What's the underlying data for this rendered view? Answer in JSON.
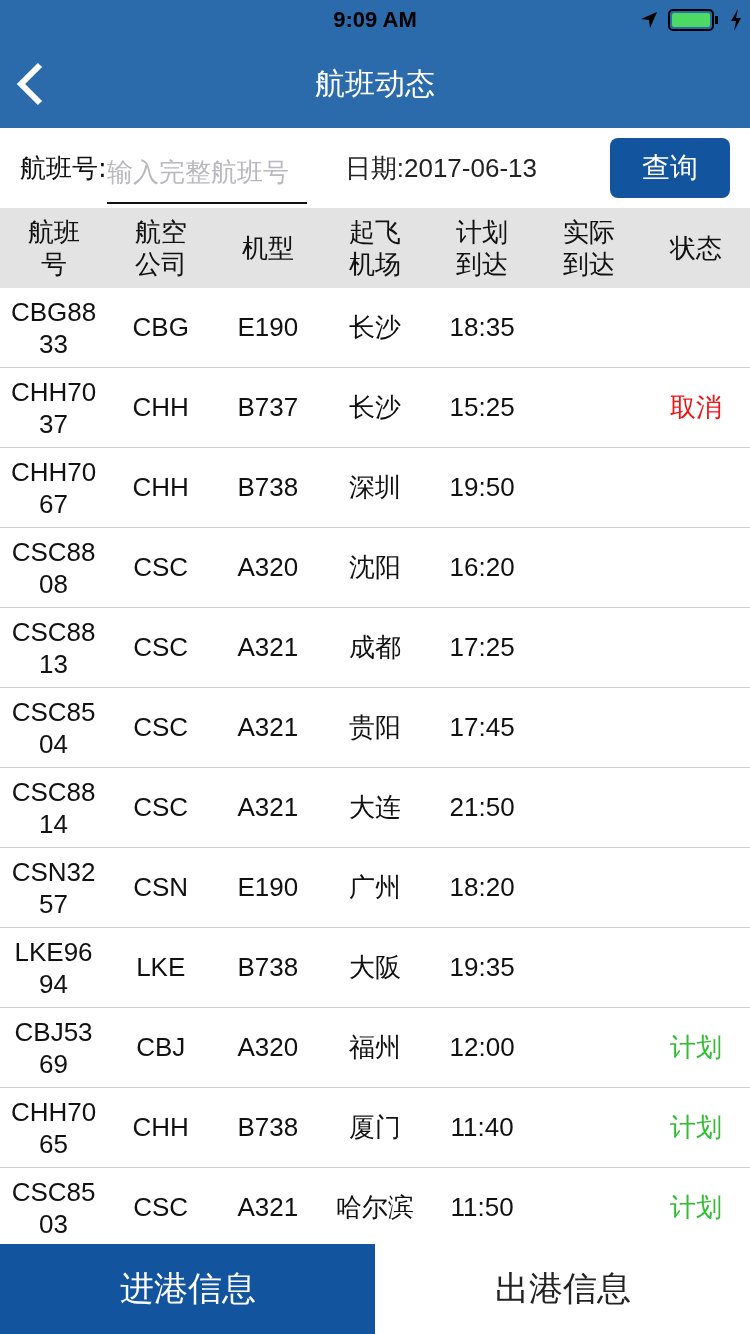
{
  "status_bar": {
    "time": "9:09 AM"
  },
  "nav": {
    "title": "航班动态"
  },
  "search": {
    "label": "航班号:",
    "placeholder": "输入完整航班号",
    "date": "日期:2017-06-13",
    "button": "查询"
  },
  "table": {
    "columns": [
      "航班号",
      "航空公司",
      "机型",
      "起飞机场",
      "计划到达",
      "实际到达",
      "状态"
    ],
    "rows": [
      {
        "flight": "CBG8833",
        "airline": "CBG",
        "aircraft": "E190",
        "origin": "长沙",
        "scheduled": "18:35"
      },
      {
        "flight": "CHH7037",
        "airline": "CHH",
        "aircraft": "B737",
        "origin": "长沙",
        "scheduled": "15:25",
        "status": {
          "text": "取消",
          "kind": "cancelled"
        }
      },
      {
        "flight": "CHH7067",
        "airline": "CHH",
        "aircraft": "B738",
        "origin": "深圳",
        "scheduled": "19:50"
      },
      {
        "flight": "CSC8808",
        "airline": "CSC",
        "aircraft": "A320",
        "origin": "沈阳",
        "scheduled": "16:20"
      },
      {
        "flight": "CSC8813",
        "airline": "CSC",
        "aircraft": "A321",
        "origin": "成都",
        "scheduled": "17:25"
      },
      {
        "flight": "CSC8504",
        "airline": "CSC",
        "aircraft": "A321",
        "origin": "贵阳",
        "scheduled": "17:45"
      },
      {
        "flight": "CSC8814",
        "airline": "CSC",
        "aircraft": "A321",
        "origin": "大连",
        "scheduled": "21:50"
      },
      {
        "flight": "CSN3257",
        "airline": "CSN",
        "aircraft": "E190",
        "origin": "广州",
        "scheduled": "18:20"
      },
      {
        "flight": "LKE9694",
        "airline": "LKE",
        "aircraft": "B738",
        "origin": "大阪",
        "scheduled": "19:35"
      },
      {
        "flight": "CBJ5369",
        "airline": "CBJ",
        "aircraft": "A320",
        "origin": "福州",
        "scheduled": "12:00",
        "status": {
          "text": "计划",
          "kind": "planned"
        }
      },
      {
        "flight": "CHH7065",
        "airline": "CHH",
        "aircraft": "B738",
        "origin": "厦门",
        "scheduled": "11:40",
        "status": {
          "text": "计划",
          "kind": "planned"
        }
      },
      {
        "flight": "CSC8503",
        "airline": "CSC",
        "aircraft": "A321",
        "origin": "哈尔滨",
        "scheduled": "11:50",
        "status": {
          "text": "计划",
          "kind": "planned"
        }
      }
    ]
  },
  "tabs": [
    {
      "label": "进港信息",
      "selected": true
    },
    {
      "label": "出港信息",
      "selected": false
    }
  ]
}
